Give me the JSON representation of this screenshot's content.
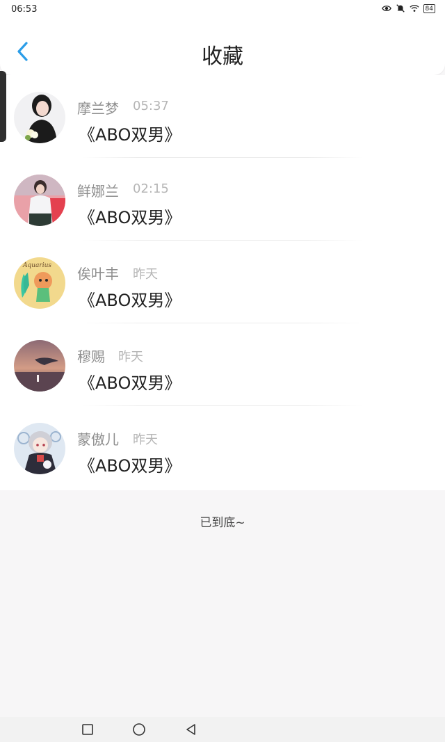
{
  "status_bar": {
    "time": "06:53",
    "battery": "84"
  },
  "header": {
    "title": "收藏"
  },
  "items": [
    {
      "name": "摩兰梦",
      "time": "05:37",
      "title": "《ABO双男》"
    },
    {
      "name": "鲜娜兰",
      "time": "02:15",
      "title": "《ABO双男》"
    },
    {
      "name": "俟叶丰",
      "time": "昨天",
      "title": "《ABO双男》"
    },
    {
      "name": "穆赐",
      "time": "昨天",
      "title": "《ABO双男》"
    },
    {
      "name": "蒙傲儿",
      "time": "昨天",
      "title": "《ABO双男》"
    }
  ],
  "footer": {
    "end_text": "已到底~"
  },
  "avatar_3_text": "Aquarius",
  "colors": {
    "accent": "#2b9de8",
    "bg": "#f7f6f7"
  }
}
